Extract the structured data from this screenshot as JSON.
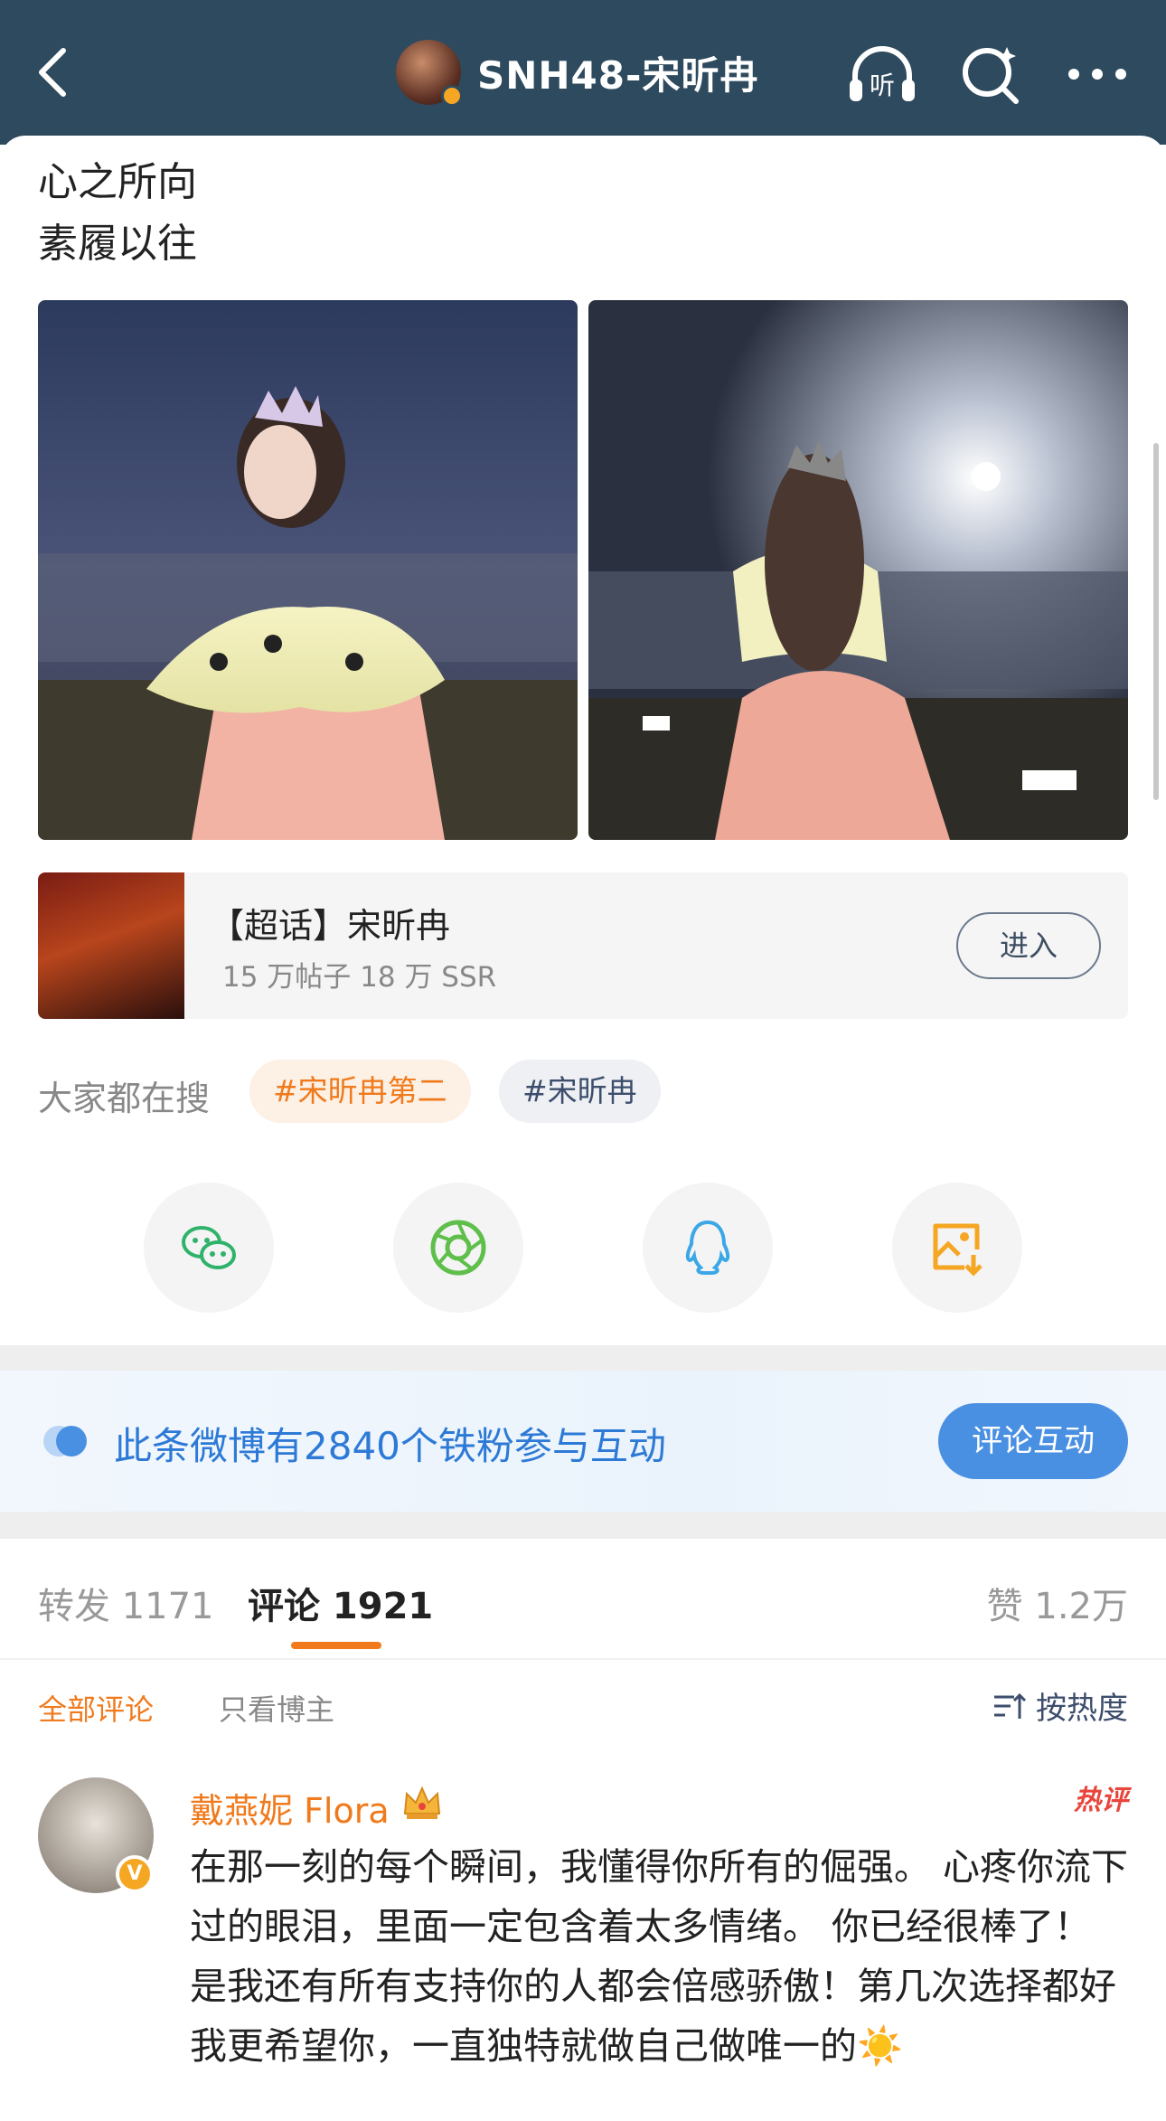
{
  "header": {
    "title": "SNH48-宋昕冉",
    "background_color": "#2e4a5e",
    "icons": [
      "back-icon",
      "listen-icon",
      "search-icon",
      "more-icon"
    ],
    "listen_label": "听"
  },
  "post": {
    "lines": [
      "心之所向",
      "素履以往"
    ],
    "images": [
      "stage-photo-1",
      "stage-photo-2"
    ]
  },
  "super_topic": {
    "name": "【超话】宋昕冉",
    "stats": "15 万帖子 18 万 SSR",
    "enter_label": "进入"
  },
  "search": {
    "label": "大家都在搜",
    "chips": [
      "#宋昕冉第二",
      "#宋昕冉"
    ]
  },
  "share": {
    "items": [
      "wechat-icon",
      "moments-icon",
      "qq-icon",
      "save-image-icon"
    ]
  },
  "fans_banner": {
    "text": "此条微博有2840个铁粉参与互动",
    "button_label": "评论互动"
  },
  "tabs": {
    "repost": "转发 1171",
    "comments": "评论 1921",
    "likes": "赞 1.2万",
    "active": "comments",
    "accent_color": "#f07a1c"
  },
  "comment_filter": {
    "all": "全部评论",
    "owner_only": "只看博主",
    "sort": "按热度"
  },
  "comments": [
    {
      "author": "戴燕妮 Flora",
      "badge": "V",
      "tag": "热评",
      "text": "在那一刻的每个瞬间，我懂得你所有的倔强。 心疼你流下过的眼泪，里面一定包含着太多情绪。 你已经很棒了！ 是我还有所有支持你的人都会倍感骄傲！第几次选择都好我更希望你，一直独特就做自己做唯一的☀️"
    }
  ]
}
